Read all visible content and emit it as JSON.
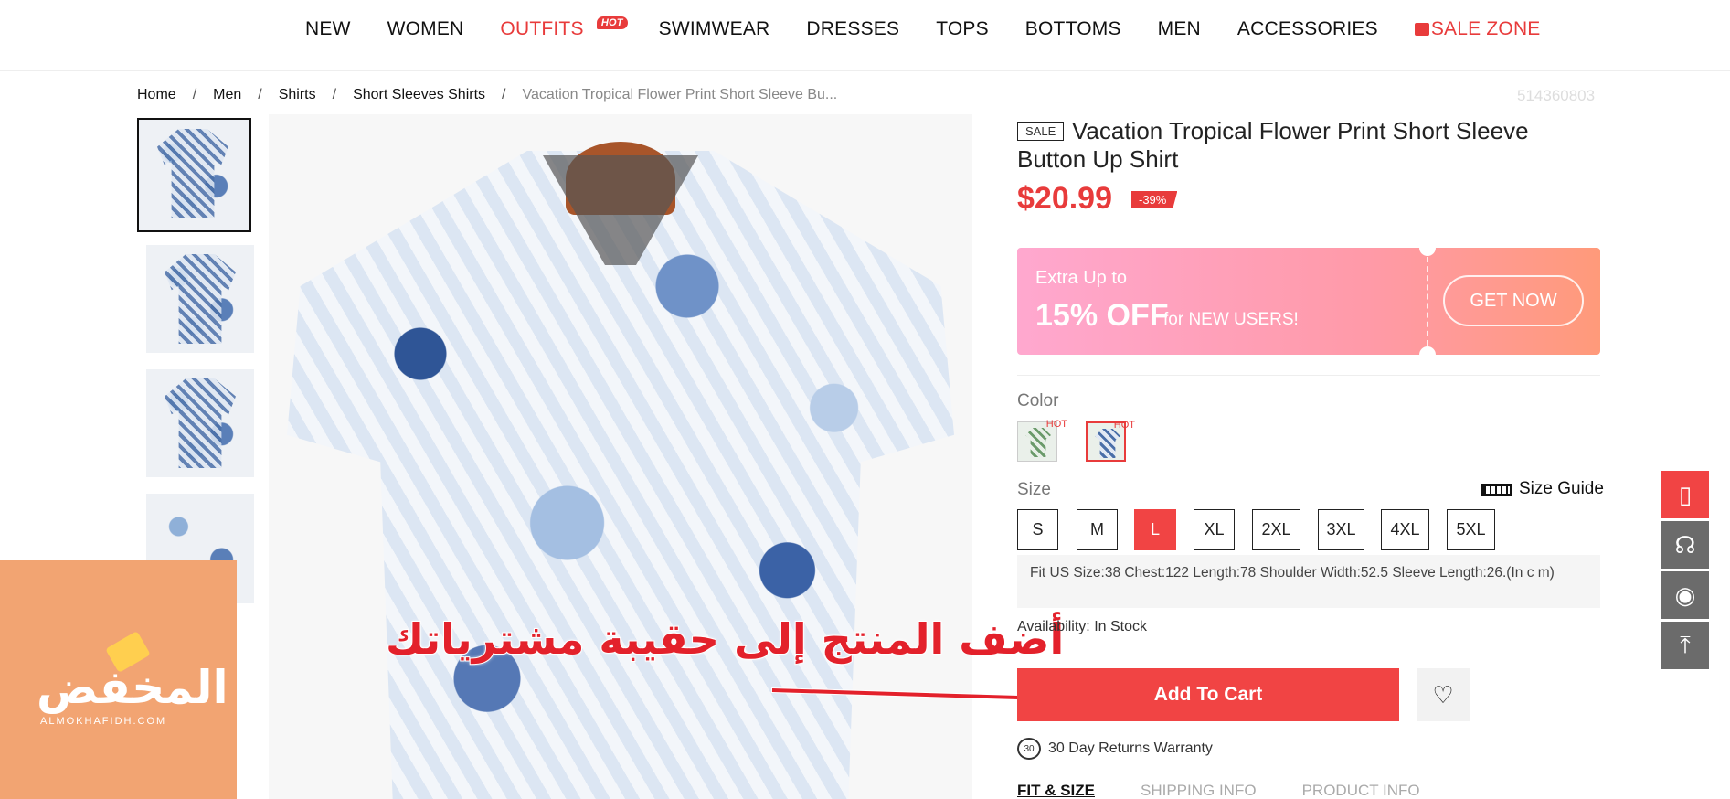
{
  "nav": {
    "items": [
      {
        "label": "NEW"
      },
      {
        "label": "WOMEN"
      },
      {
        "label": "OUTFITS",
        "badge": "HOT",
        "color": "#e83b3b"
      },
      {
        "label": "SWIMWEAR"
      },
      {
        "label": "DRESSES"
      },
      {
        "label": "TOPS"
      },
      {
        "label": "BOTTOMS"
      },
      {
        "label": "MEN"
      },
      {
        "label": "ACCESSORIES"
      },
      {
        "label": "SALE ZONE",
        "color": "#e83b3b"
      }
    ]
  },
  "breadcrumb": [
    "Home",
    "Men",
    "Shirts",
    "Short Sleeves Shirts",
    "Vacation Tropical Flower Print Short Sleeve Bu..."
  ],
  "sku": "514360803",
  "logo": {
    "text": "المخفض",
    "sub": "ALMOKHAFIDH.COM"
  },
  "annotation": {
    "text": "أضف المنتج إلى حقيبة مشترياتك"
  },
  "product": {
    "sale_tag": "SALE",
    "title": "Vacation Tropical Flower Print Short Sleeve Button Up Shirt",
    "price": "$20.99",
    "discount": "-39%",
    "promo": {
      "line1": "Extra Up to",
      "big": "15% OFF",
      "small": "for NEW USERS!",
      "button": "GET NOW"
    },
    "color_label": "Color",
    "colors": [
      {
        "hot": "HOT",
        "swatch": "#6a9a6a"
      },
      {
        "hot": "HOT",
        "swatch": "#4a6fa8"
      }
    ],
    "size_label": "Size",
    "size_guide": "Size Guide",
    "sizes": [
      "S",
      "M",
      "L",
      "XL",
      "2XL",
      "3XL",
      "4XL",
      "5XL"
    ],
    "selected_size": "L",
    "fit_info": "Fit US Size:38    Chest:122    Length:78    Shoulder Width:52.5    Sleeve Length:26.(In c m)",
    "availability": "Availability: In Stock",
    "add_to_cart": "Add To Cart",
    "returns": "30 Day Returns Warranty",
    "returns_icon_label": "30",
    "tabs": [
      "FIT & SIZE",
      "SHIPPING INFO",
      "PRODUCT INFO"
    ]
  },
  "colors": {
    "accent": "#f14444",
    "brand_red": "#e83b3b"
  }
}
